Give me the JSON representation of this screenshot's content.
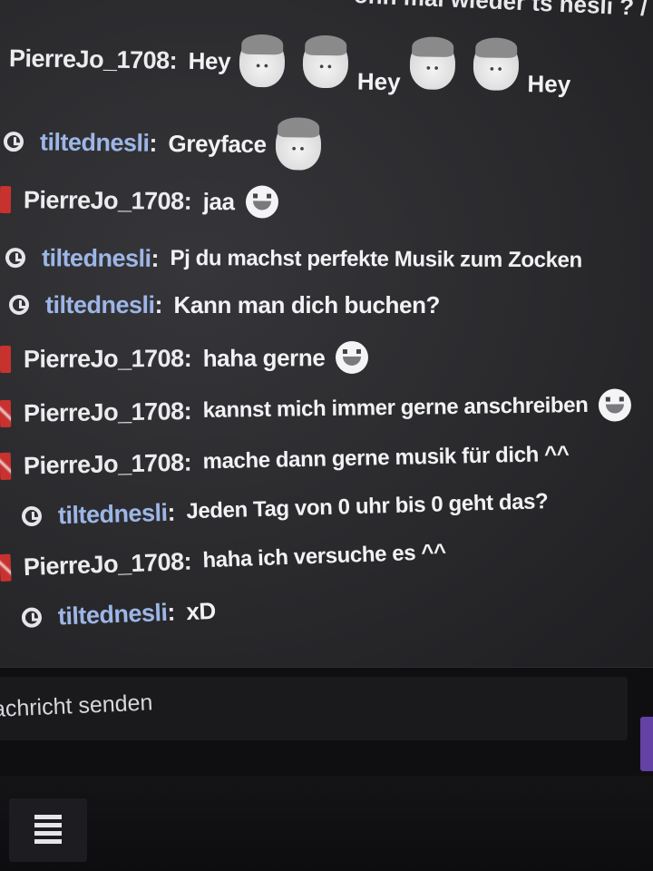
{
  "chat": {
    "top_fragment": "ohn mal wieder ts nesli ? /",
    "messages": [
      {
        "user": "PierreJo_1708",
        "badge": "none",
        "text": "Hey",
        "emotes": [
          "face",
          "face",
          "Hey",
          "face",
          "face",
          "Hey"
        ]
      },
      {
        "user": "tiltednesli",
        "badge": "clock",
        "text": "Greyface",
        "emotes": [
          "face"
        ]
      },
      {
        "user": "PierreJo_1708",
        "badge": "red",
        "text": "jaa",
        "emotes": [
          "smile"
        ]
      },
      {
        "user": "tiltednesli",
        "badge": "clock",
        "text": "Pj du machst perfekte Musik zum Zocken",
        "emotes": []
      },
      {
        "user": "tiltednesli",
        "badge": "clock",
        "text": "Kann man dich buchen?",
        "emotes": []
      },
      {
        "user": "PierreJo_1708",
        "badge": "red",
        "text": "haha gerne",
        "emotes": [
          "smile"
        ]
      },
      {
        "user": "PierreJo_1708",
        "badge": "red-x",
        "text": "kannst mich immer gerne anschreiben",
        "emotes": [
          "smile"
        ]
      },
      {
        "user": "PierreJo_1708",
        "badge": "red-x",
        "text": "mache dann gerne musik für dich ^^",
        "emotes": []
      },
      {
        "user": "tiltednesli",
        "badge": "clock",
        "text": "Jeden Tag von 0 uhr bis 0 geht das?",
        "emotes": []
      },
      {
        "user": "PierreJo_1708",
        "badge": "red-x",
        "text": "haha ich versuche es ^^",
        "emotes": []
      },
      {
        "user": "tiltednesli",
        "badge": "clock",
        "text": "xD",
        "emotes": []
      }
    ],
    "colon": ":"
  },
  "input": {
    "placeholder": "achricht senden"
  },
  "colors": {
    "chat_bg": "#2a2a2d",
    "username_pj": "#ececef",
    "username_tn": "#9db6e6",
    "send_button": "#6441a4",
    "badge_red": "#c8322e"
  },
  "icons": {
    "mod_badge": "clock-icon",
    "sub_badge": "red-badge-icon",
    "list": "list-icon"
  }
}
